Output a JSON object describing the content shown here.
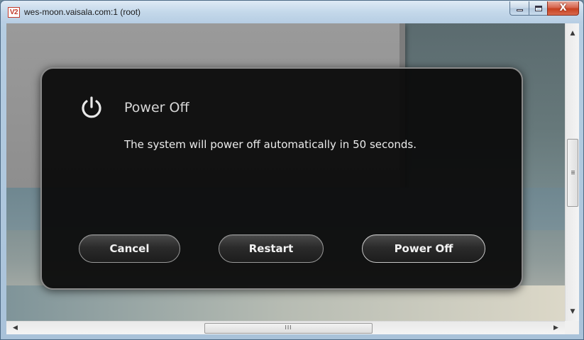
{
  "window": {
    "title": "wes-moon.vaisala.com:1 (root)",
    "app_icon_text": "V2",
    "controls": {
      "minimize": "minimize-icon",
      "maximize": "maximize-icon",
      "close": "close-icon",
      "close_glyph": "X"
    }
  },
  "dialog": {
    "icon": "power-icon",
    "title": "Power Off",
    "message": "The system will power off automatically in 50 seconds.",
    "buttons": {
      "cancel": "Cancel",
      "restart": "Restart",
      "power_off": "Power Off"
    }
  },
  "scrollbars": {
    "up_arrow": "▲",
    "down_arrow": "▼",
    "left_arrow": "◀",
    "right_arrow": "▶",
    "h_thumb_grip": "III"
  },
  "colors": {
    "dialog_bg": "#0a0a0a",
    "dialog_border": "#8a8a8a",
    "close_button": "#c7401f"
  }
}
